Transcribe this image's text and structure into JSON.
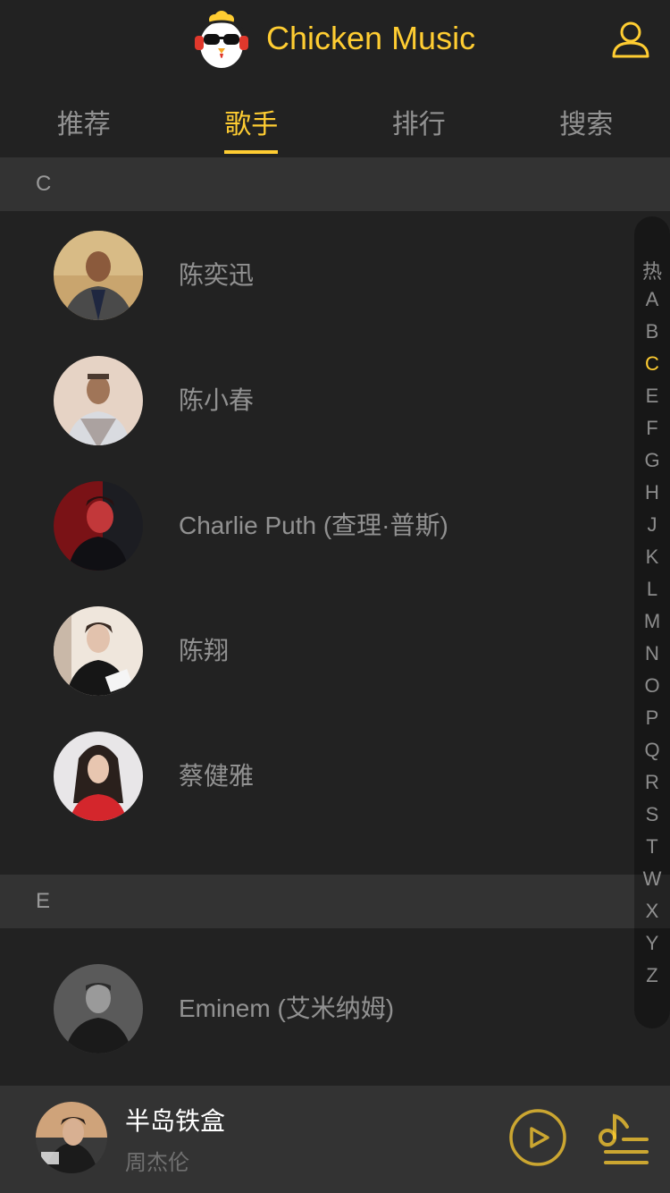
{
  "header": {
    "title": "Chicken Music"
  },
  "tabs": [
    {
      "label": "推荐"
    },
    {
      "label": "歌手"
    },
    {
      "label": "排行"
    },
    {
      "label": "搜索"
    }
  ],
  "groups": [
    {
      "title": "C",
      "items": [
        {
          "name": "陈奕迅"
        },
        {
          "name": "陈小春"
        },
        {
          "name": "Charlie Puth (查理·普斯)"
        },
        {
          "name": "陈翔"
        },
        {
          "name": "蔡健雅"
        }
      ]
    },
    {
      "title": "E",
      "items": [
        {
          "name": "Eminem (艾米纳姆)"
        }
      ]
    }
  ],
  "shortcut": [
    "热",
    "A",
    "B",
    "C",
    "E",
    "F",
    "G",
    "H",
    "J",
    "K",
    "L",
    "M",
    "N",
    "O",
    "P",
    "Q",
    "R",
    "S",
    "T",
    "W",
    "X",
    "Y",
    "Z"
  ],
  "shortcut_active": "C",
  "player": {
    "song": "半岛铁盒",
    "singer": "周杰伦"
  },
  "colors": {
    "accent": "#ffcd32",
    "background": "#222222",
    "panel": "#333333"
  }
}
